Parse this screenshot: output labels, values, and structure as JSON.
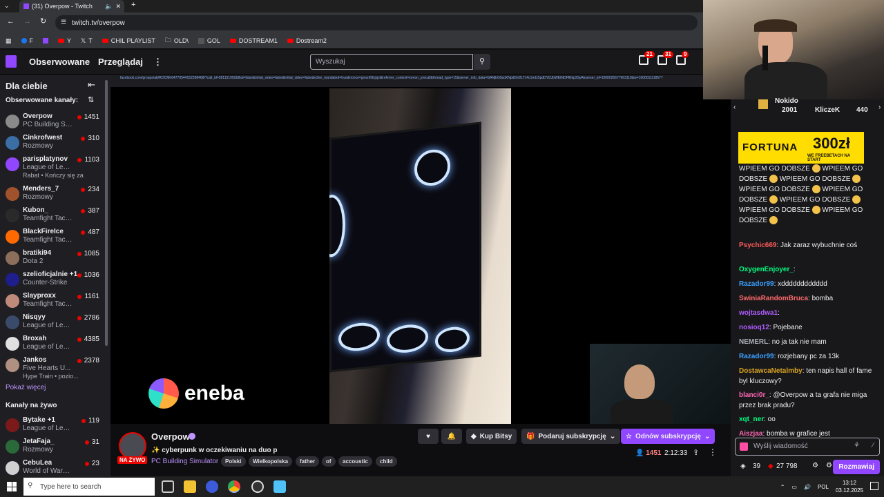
{
  "browser": {
    "tab_title": "(31) Overpow - Twitch",
    "url": "twitch.tv/overpow",
    "bookmarks": [
      {
        "label": "F"
      },
      {
        "label": "Y"
      },
      {
        "label": "T"
      },
      {
        "label": "CHIL PLAYLIST"
      },
      {
        "label": "OLD\\"
      },
      {
        "label": "GOL"
      },
      {
        "label": "DOSTREAM1"
      },
      {
        "label": "Dostream2"
      }
    ]
  },
  "topnav": {
    "following": "Obserwowane",
    "browse": "Przeglądaj",
    "search_placeholder": "Wyszukaj",
    "badges": [
      "21",
      "31",
      "9"
    ]
  },
  "sidebar": {
    "title": "Dla ciebie",
    "followed_header": "Obserwowane kanały:",
    "channels": [
      {
        "name": "Overpow",
        "game": "PC Building Si...",
        "viewers": "1451",
        "color": "#8a8a8a"
      },
      {
        "name": "Cinkrofwest",
        "game": "Rozmowy",
        "viewers": "310",
        "color": "#3a6ea5"
      },
      {
        "name": "parisplatynov",
        "game": "League of Leg...",
        "viewers": "1103",
        "color": "#9146ff",
        "extra": "Rabat • Kończy się za"
      },
      {
        "name": "Menders_7",
        "game": "Rozmowy",
        "viewers": "234",
        "color": "#a0522d"
      },
      {
        "name": "Kubon_",
        "game": "Teamfight Tacti...",
        "viewers": "387",
        "color": "#2a2a2a"
      },
      {
        "name": "BlackFireIce",
        "game": "Teamfight Tacti...",
        "viewers": "487",
        "color": "#ff6a00"
      },
      {
        "name": "bratiki94",
        "game": "Dota 2",
        "viewers": "1085",
        "color": "#8b6f5a"
      },
      {
        "name": "szelioficjalnie +1",
        "game": "Counter-Strike",
        "viewers": "1036",
        "color": "#1e1e8c"
      },
      {
        "name": "Slayproxx",
        "game": "Teamfight Tacti...",
        "viewers": "1161",
        "color": "#c08a7a"
      },
      {
        "name": "Nisqyy",
        "game": "League of Leg...",
        "viewers": "2786",
        "color": "#3a4a6a"
      },
      {
        "name": "Broxah",
        "game": "League of Leg...",
        "viewers": "4385",
        "color": "#e0e0e0"
      },
      {
        "name": "Jankos",
        "game": "Five Hearts U...",
        "viewers": "2378",
        "color": "#b09080",
        "extra": "Hype Train • pozio..."
      }
    ],
    "show_more": "Pokaż więcej",
    "live_header": "Kanały na żywo",
    "live_channels": [
      {
        "name": "Bytake +1",
        "game": "League of Lege...",
        "viewers": "119",
        "color": "#7a1a1a"
      },
      {
        "name": "JetaFaja_",
        "game": "Rozmowy",
        "viewers": "31",
        "color": "#2a6a3a"
      },
      {
        "name": "CebuLea",
        "game": "World of Warcr...",
        "viewers": "23",
        "color": "#d0d0d0"
      }
    ]
  },
  "player": {
    "url_text": "facebook.com/groups/ab/ROCMh64770544152398468/?call_id=281151992&lfsd=false&initial_video=false&initial_video=false&e2ee_mandated=true&nonce=gmxnl9lxjyjsl&referrer_context=zenon_precall&thread_type=15&server_info_data=GANjbG9sdXNpdGV2LTJ4c1mUSpdDYi2JbWEtNDFfEkp3SyAkserser_id=1000025677963118&w=1000011118577",
    "sponsor": "eneba"
  },
  "stream": {
    "name": "Overpow",
    "live": "NA ŻYWO",
    "title": "cyberpunk w oczekiwaniu na duo p",
    "category": "PC Building Simulator",
    "tags": [
      "Polski",
      "Wielkopolska",
      "father",
      "of",
      "accoustic",
      "child"
    ],
    "viewers": "1451",
    "uptime": "2:12:33",
    "buttons": {
      "bits": "Kup Bitsy",
      "gift": "Podaruj subskrypcję",
      "resub": "Odnów subskrypcję"
    }
  },
  "chat": {
    "leaders": [
      {
        "name": "Nokido",
        "amount": "2001"
      },
      {
        "name": "KliczeK",
        "amount": "440"
      }
    ],
    "ad": {
      "brand": "FORTUNA",
      "amount": "300zł",
      "tagline": "WE FREEBETACH NA START"
    },
    "spam_text": "WPIEEM GO DOBSZE",
    "messages": [
      {
        "user": "Psychic669",
        "text": ": Jak zaraz wybuchnie coś",
        "color": "#ff5a5a"
      },
      {
        "user": "OxygenEnjoyer_",
        "text": ":",
        "color": "#00ff7f"
      },
      {
        "user": "Razador99",
        "text": ": xdddddddddddd",
        "color": "#3aa0ff"
      },
      {
        "user": "SwiniaRandomBruca",
        "text": ": bomba",
        "color": "#ff6a6a"
      },
      {
        "user": "wojtasdwa1",
        "text": ":",
        "color": "#b05cff"
      },
      {
        "user": "nosioq12",
        "text": ": Pojebane",
        "color": "#b05cff"
      },
      {
        "user": "NEMERL",
        "text": ": no ja tak nie mam",
        "color": "#adadb8"
      },
      {
        "user": "Razador99",
        "text": ": rozjebany pc za 13k",
        "color": "#3aa0ff"
      },
      {
        "user": "DostawcaNetalmby",
        "text": ": ten napis hall of fame byl kluczowy?",
        "color": "#daa520"
      },
      {
        "user": "blanci0r_",
        "text": ": @Overpow a ta grafa nie miga przez brak pradu?",
        "color": "#ff69b4"
      },
      {
        "user": "xqt_ner",
        "text": ": oo",
        "color": "#00ff7f"
      },
      {
        "user": "Aiszjaa",
        "text": ": bomba w grafice jest",
        "color": "#ff69b4"
      }
    ],
    "input_placeholder": "Wyślij wiadomość",
    "points": "39",
    "bits": "27 798",
    "send_label": "Rozmawiaj"
  },
  "taskbar": {
    "search_placeholder": "Type here to search",
    "lang": "POL",
    "time": "13:12",
    "date": "03.12.2025"
  }
}
